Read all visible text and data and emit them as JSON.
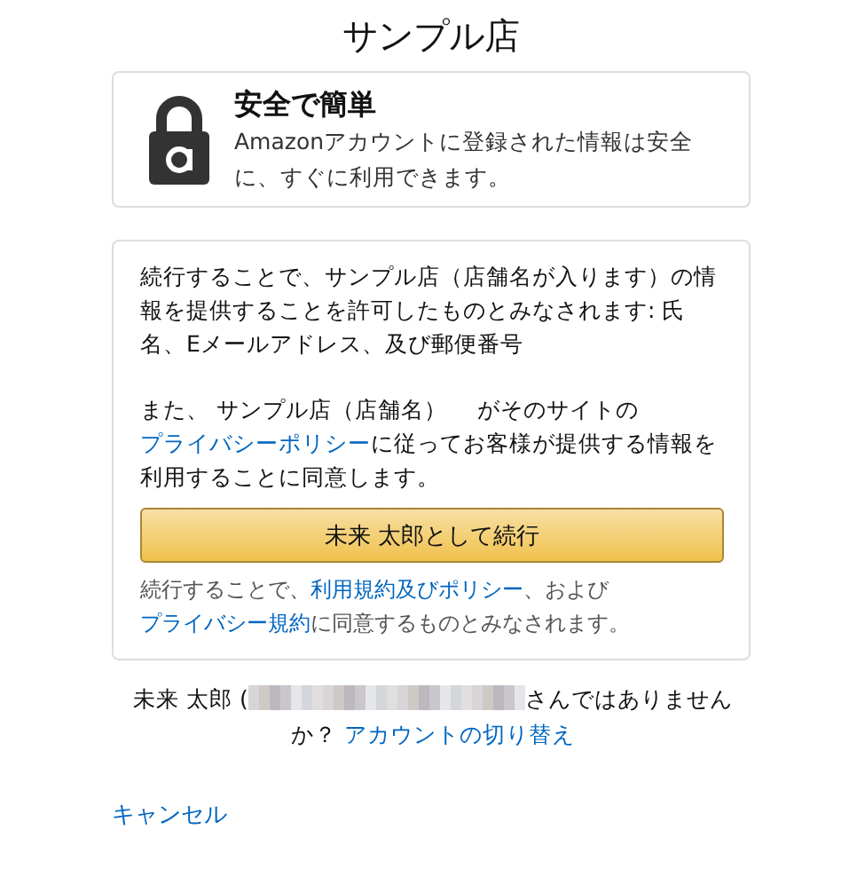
{
  "title": "サンプル店",
  "security_card": {
    "heading": "安全で簡単",
    "text": "Amazonアカウントに登録された情報は安全に、すぐに利用できます。"
  },
  "consent_card": {
    "paragraphs": [
      [
        {
          "kind": "text",
          "text": "続行することで、サンプル店（店舗名が入ります）の情報を提供することを許可したものとみなされます: 氏名、Eメールアドレス、及び郵便番号"
        }
      ],
      [
        {
          "kind": "text",
          "text": "また、 サンプル店（店舗名）　 がそのサイトの"
        },
        {
          "kind": "link",
          "text": "プライバシーポリシー"
        },
        {
          "kind": "text",
          "text": "に従ってお客様が提供する情報を利用することに同意します。"
        }
      ]
    ],
    "continue_button": "未来 太郎として続行",
    "terms": [
      {
        "kind": "text",
        "text": "続行することで、"
      },
      {
        "kind": "link",
        "text": "利用規約及びポリシー"
      },
      {
        "kind": "text",
        "text": "、および"
      },
      {
        "kind": "link",
        "text": "プライバシー規約"
      },
      {
        "kind": "text",
        "text": "に同意するものとみなされます。"
      }
    ]
  },
  "account_notice": {
    "name_prefix": "未来 太郎 (",
    "suffix": "さんではありませんか？",
    "switch_link": "アカウントの切り替え"
  },
  "cancel_link": "キャンセル"
}
